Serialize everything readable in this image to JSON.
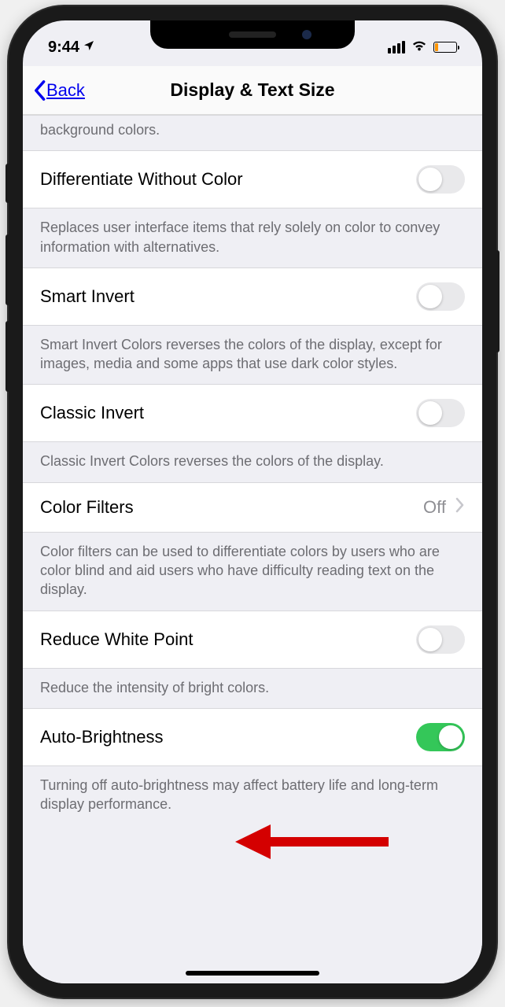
{
  "status": {
    "time": "9:44",
    "location_arrow": "location-icon",
    "signal_label": "cellular-signal",
    "wifi_label": "wifi",
    "battery_level_color": "#ff9500"
  },
  "nav": {
    "back_label": "Back",
    "title": "Display & Text Size"
  },
  "rows": {
    "truncated_desc": "background colors.",
    "diff_without_color": {
      "label": "Differentiate Without Color",
      "desc": "Replaces user interface items that rely solely on color to convey information with alternatives.",
      "on": false
    },
    "smart_invert": {
      "label": "Smart Invert",
      "desc": "Smart Invert Colors reverses the colors of the display, except for images, media and some apps that use dark color styles.",
      "on": false
    },
    "classic_invert": {
      "label": "Classic Invert",
      "desc": "Classic Invert Colors reverses the colors of the display.",
      "on": false
    },
    "color_filters": {
      "label": "Color Filters",
      "value": "Off",
      "desc": "Color filters can be used to differentiate colors by users who are color blind and aid users who have difficulty reading text on the display."
    },
    "reduce_white_point": {
      "label": "Reduce White Point",
      "desc": "Reduce the intensity of bright colors.",
      "on": false
    },
    "auto_brightness": {
      "label": "Auto-Brightness",
      "desc": "Turning off auto-brightness may affect battery life and long-term display performance.",
      "on": true
    }
  },
  "annotation": {
    "arrow_color": "#d40000"
  }
}
